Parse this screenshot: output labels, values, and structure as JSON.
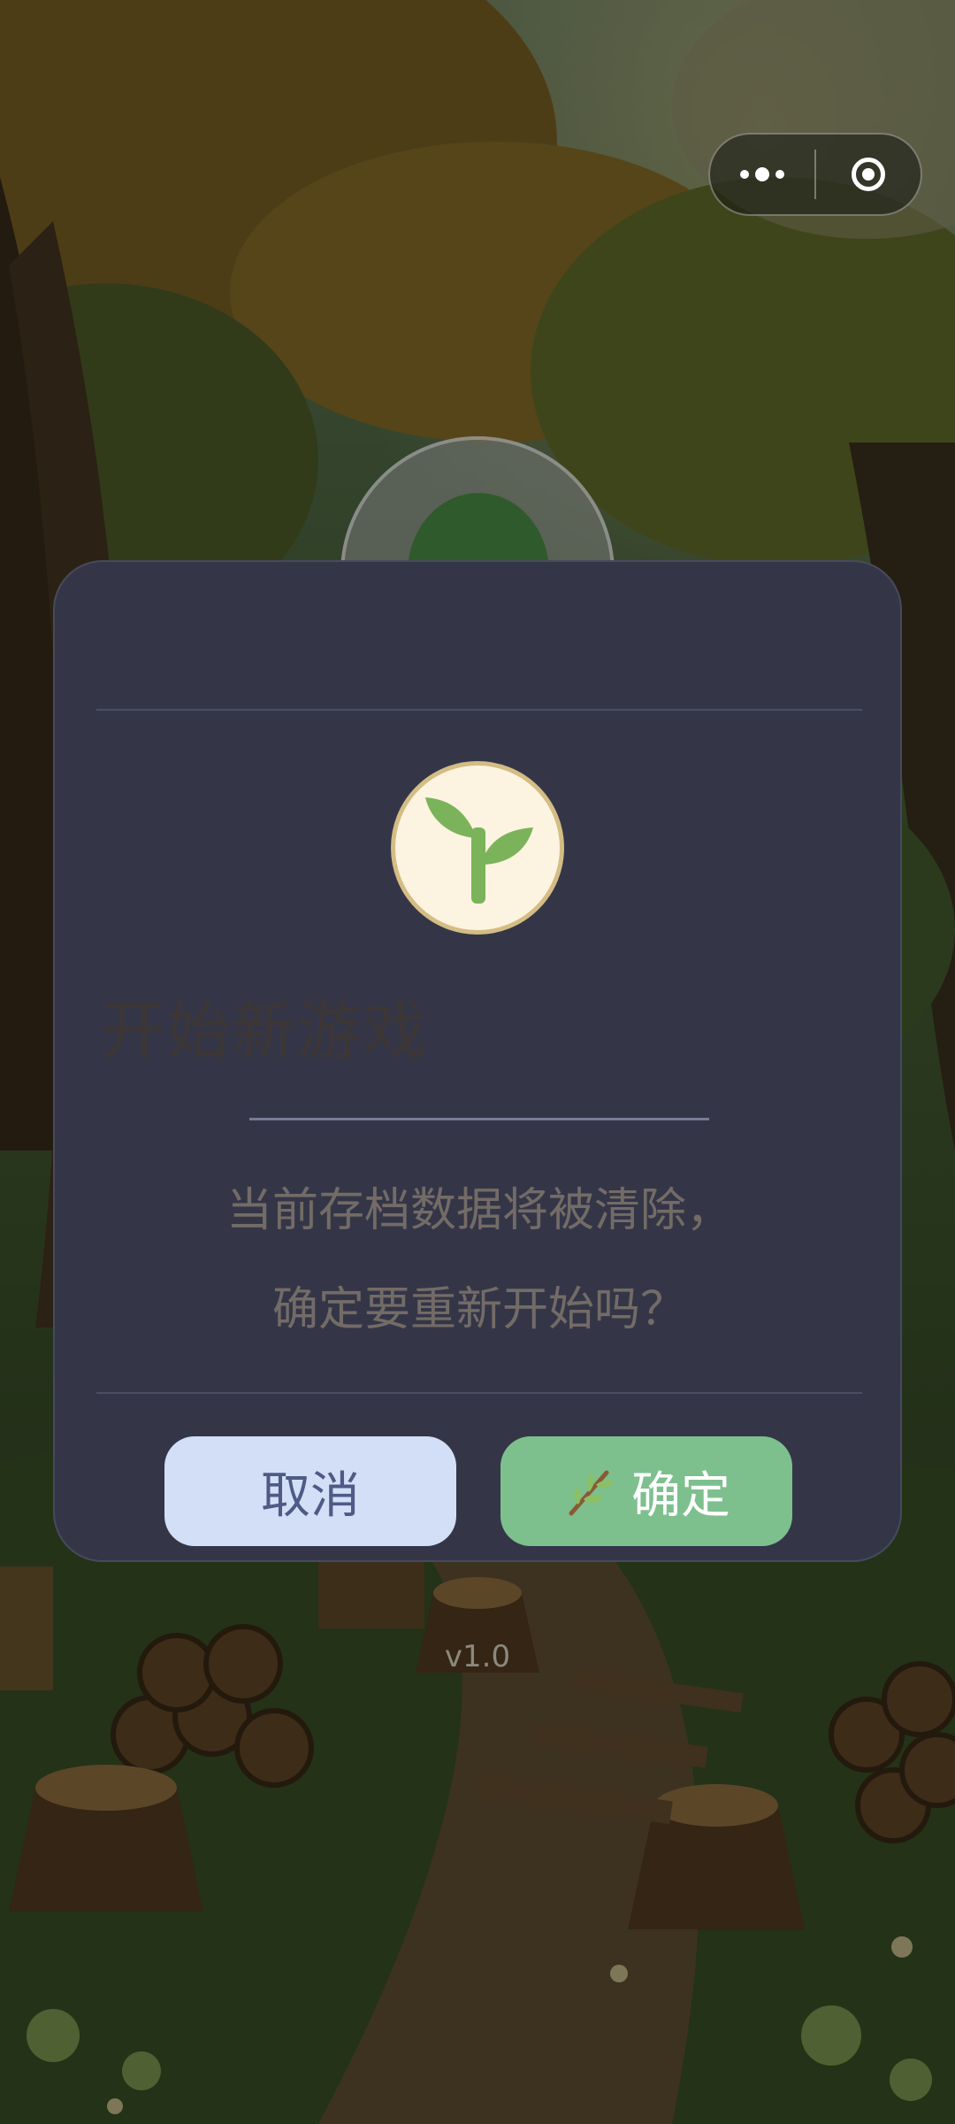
{
  "capsule": {
    "more_icon": "more-dots-icon",
    "close_icon": "target-close-icon"
  },
  "dialog": {
    "icon": "sprout-icon",
    "title": "开始新游戏",
    "message_line1": "当前存档数据将被清除，",
    "message_line2": "确定要重新开始吗？",
    "cancel_label": "取消",
    "confirm_label": "确定",
    "confirm_icon": "branch-icon"
  },
  "version": "v1.0",
  "colors": {
    "dialog_bg": "#343648",
    "cancel_bg": "#d3dff6",
    "confirm_bg": "#7dc08e",
    "sprout": "#7bb35a"
  }
}
